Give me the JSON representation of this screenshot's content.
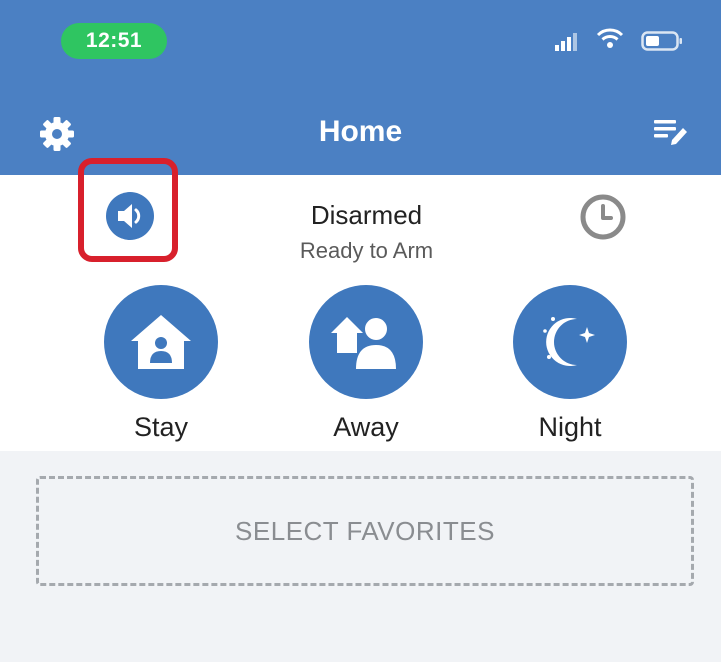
{
  "status_bar": {
    "time": "12:51"
  },
  "header": {
    "title": "Home"
  },
  "security": {
    "status": "Disarmed",
    "substatus": "Ready to Arm"
  },
  "modes": [
    {
      "label": "Stay"
    },
    {
      "label": "Away"
    },
    {
      "label": "Night"
    }
  ],
  "favorites": {
    "label": "SELECT FAVORITES"
  },
  "colors": {
    "header_bg": "#4b80c3",
    "mode_circle": "#3f78bd",
    "time_pill": "#2fc561",
    "highlight": "#d8202c",
    "history_icon": "#8a8a8a"
  },
  "icons": {
    "settings": "gear-icon",
    "edit_list": "edit-list-icon",
    "speaker": "speaker-icon",
    "history": "clock-icon",
    "stay": "house-person-icon",
    "away": "people-house-icon",
    "night": "moon-stars-icon"
  }
}
